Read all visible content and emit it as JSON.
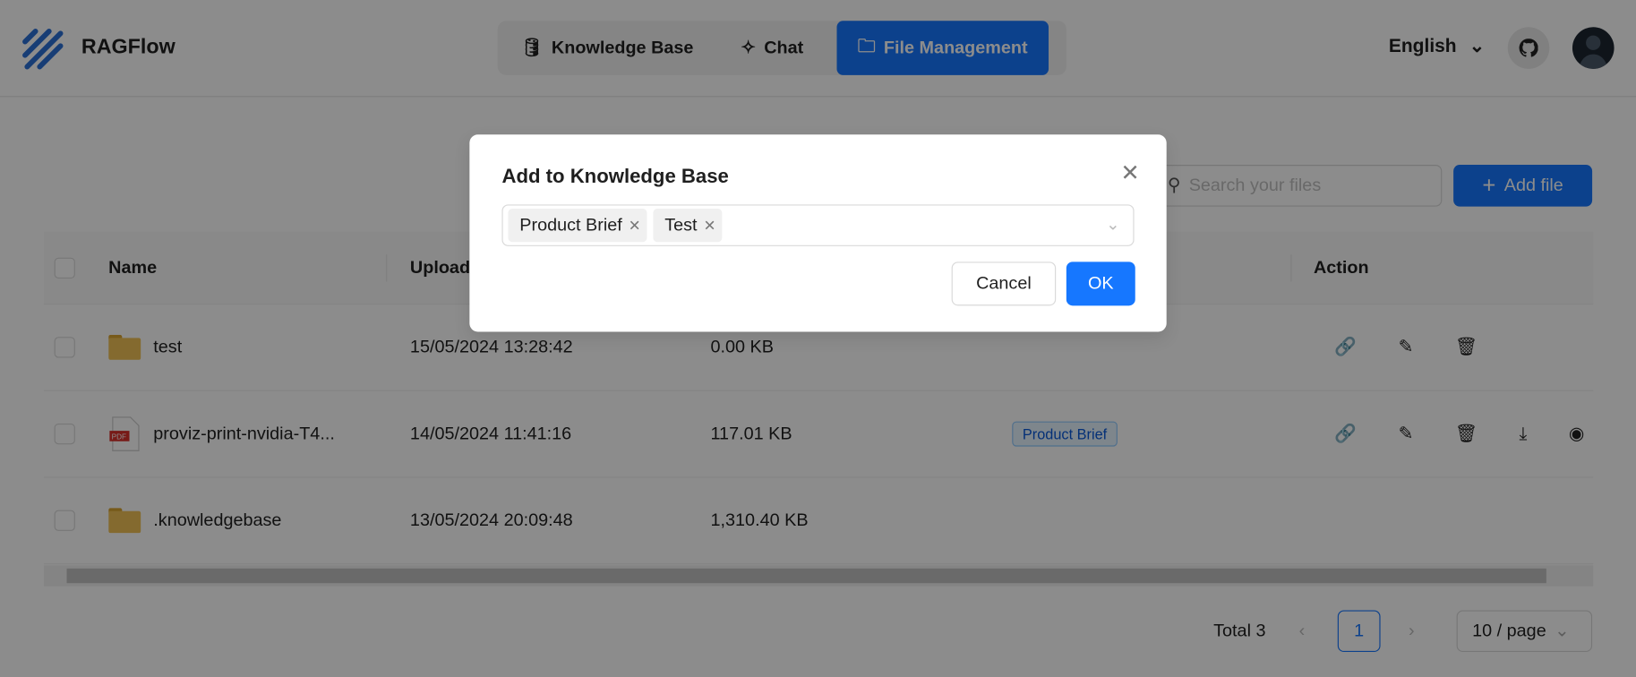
{
  "app": {
    "name": "RAGFlow"
  },
  "nav": {
    "items": [
      {
        "label": "Knowledge Base",
        "icon": "database-icon"
      },
      {
        "label": "Chat",
        "icon": "sparkle-icon"
      },
      {
        "label": "File Management",
        "icon": "folder-icon",
        "active": true
      }
    ]
  },
  "header": {
    "language": "English"
  },
  "toolbar": {
    "search_placeholder": "Search your files",
    "add_label": "Add file"
  },
  "table": {
    "columns": [
      "Name",
      "Upload",
      "Action"
    ],
    "rows": [
      {
        "name": "test",
        "type": "folder",
        "uploaded": "15/05/2024 13:28:42",
        "size": "0.00 KB",
        "kb": "",
        "actions": [
          "link",
          "edit",
          "delete"
        ]
      },
      {
        "name": "proviz-print-nvidia-T4...",
        "type": "pdf",
        "uploaded": "14/05/2024 11:41:16",
        "size": "117.01 KB",
        "kb": "Product Brief",
        "actions": [
          "link",
          "edit",
          "delete",
          "download",
          "preview"
        ]
      },
      {
        "name": ".knowledgebase",
        "type": "folder",
        "uploaded": "13/05/2024 20:09:48",
        "size": "1,310.40 KB",
        "kb": "",
        "actions": []
      }
    ]
  },
  "pagination": {
    "total": "Total 3",
    "page": "1",
    "page_size": "10 / page"
  },
  "modal": {
    "title": "Add to Knowledge Base",
    "selected": [
      "Product Brief",
      "Test"
    ],
    "cancel": "Cancel",
    "ok": "OK"
  },
  "colors": {
    "primary": "#1677ff",
    "overlay": "rgba(0,0,0,0.45)"
  }
}
